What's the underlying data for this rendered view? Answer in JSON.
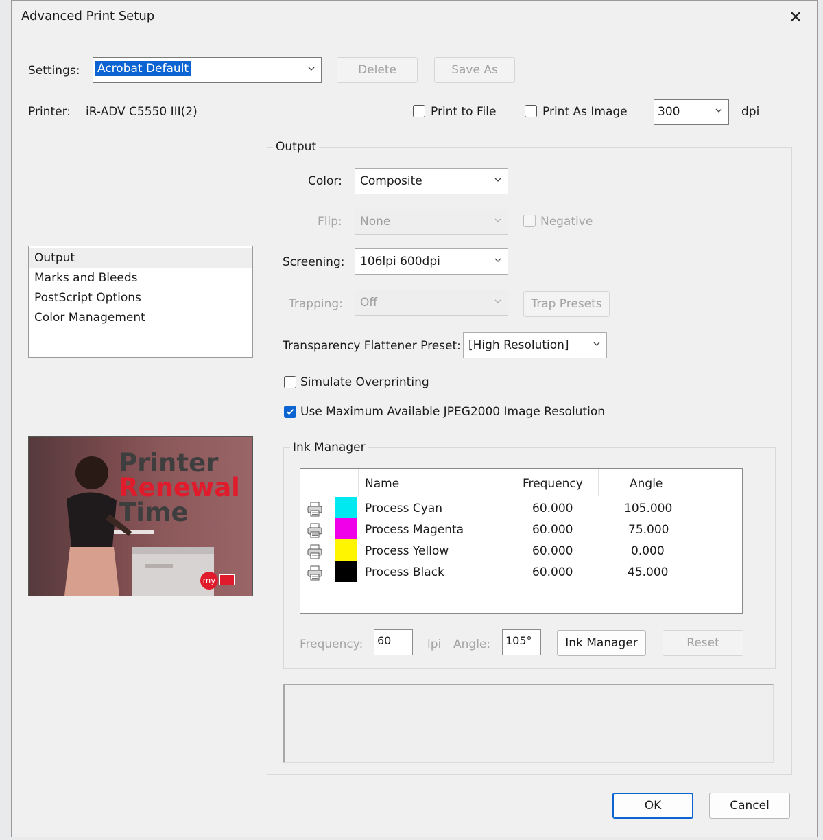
{
  "window": {
    "title": "Advanced Print Setup"
  },
  "settings": {
    "label": "Settings:",
    "value": "Acrobat Default",
    "delete_label": "Delete",
    "save_as_label": "Save As"
  },
  "printer": {
    "label": "Printer:",
    "name": "iR-ADV C5550 III(2)"
  },
  "print_to_file": {
    "label": "Print to File",
    "checked": false
  },
  "print_as_image": {
    "label": "Print As Image",
    "checked": false,
    "dpi_value": "300",
    "dpi_unit": "dpi"
  },
  "nav": {
    "items": [
      {
        "label": "Output",
        "selected": true
      },
      {
        "label": "Marks and Bleeds",
        "selected": false
      },
      {
        "label": "PostScript Options",
        "selected": false
      },
      {
        "label": "Color Management",
        "selected": false
      }
    ]
  },
  "promo": {
    "line1": "Printer",
    "line2": "Renewal",
    "line3": "Time",
    "badge": "my"
  },
  "output": {
    "title": "Output",
    "color_label": "Color:",
    "color_value": "Composite",
    "flip_label": "Flip:",
    "flip_value": "None",
    "negative_label": "Negative",
    "screening_label": "Screening:",
    "screening_value": "106lpi 600dpi",
    "trapping_label": "Trapping:",
    "trapping_value": "Off",
    "trap_presets_label": "Trap Presets",
    "flattener_label": "Transparency Flattener Preset:",
    "flattener_value": "[High Resolution]",
    "simulate_overprinting_label": "Simulate Overprinting",
    "simulate_overprinting_checked": false,
    "jpeg2000_label": "Use Maximum Available JPEG2000 Image Resolution",
    "jpeg2000_checked": true
  },
  "ink_manager": {
    "title": "Ink Manager",
    "headers": {
      "name": "Name",
      "frequency": "Frequency",
      "angle": "Angle"
    },
    "rows": [
      {
        "name": "Process Cyan",
        "frequency": "60.000",
        "angle": "105.000",
        "color": "#00e8f0"
      },
      {
        "name": "Process Magenta",
        "frequency": "60.000",
        "angle": "75.000",
        "color": "#ef00e8"
      },
      {
        "name": "Process Yellow",
        "frequency": "60.000",
        "angle": "0.000",
        "color": "#fff500"
      },
      {
        "name": "Process Black",
        "frequency": "60.000",
        "angle": "45.000",
        "color": "#000000"
      }
    ],
    "frequency_label": "Frequency:",
    "frequency_value": "60",
    "lpi_label": "lpi",
    "angle_label": "Angle:",
    "angle_value": "105°",
    "ink_manager_button": "Ink Manager",
    "reset_button": "Reset"
  },
  "footer": {
    "ok_label": "OK",
    "cancel_label": "Cancel"
  },
  "colors": {
    "accent": "#0b64d1",
    "promo_red": "#e01b2c"
  }
}
